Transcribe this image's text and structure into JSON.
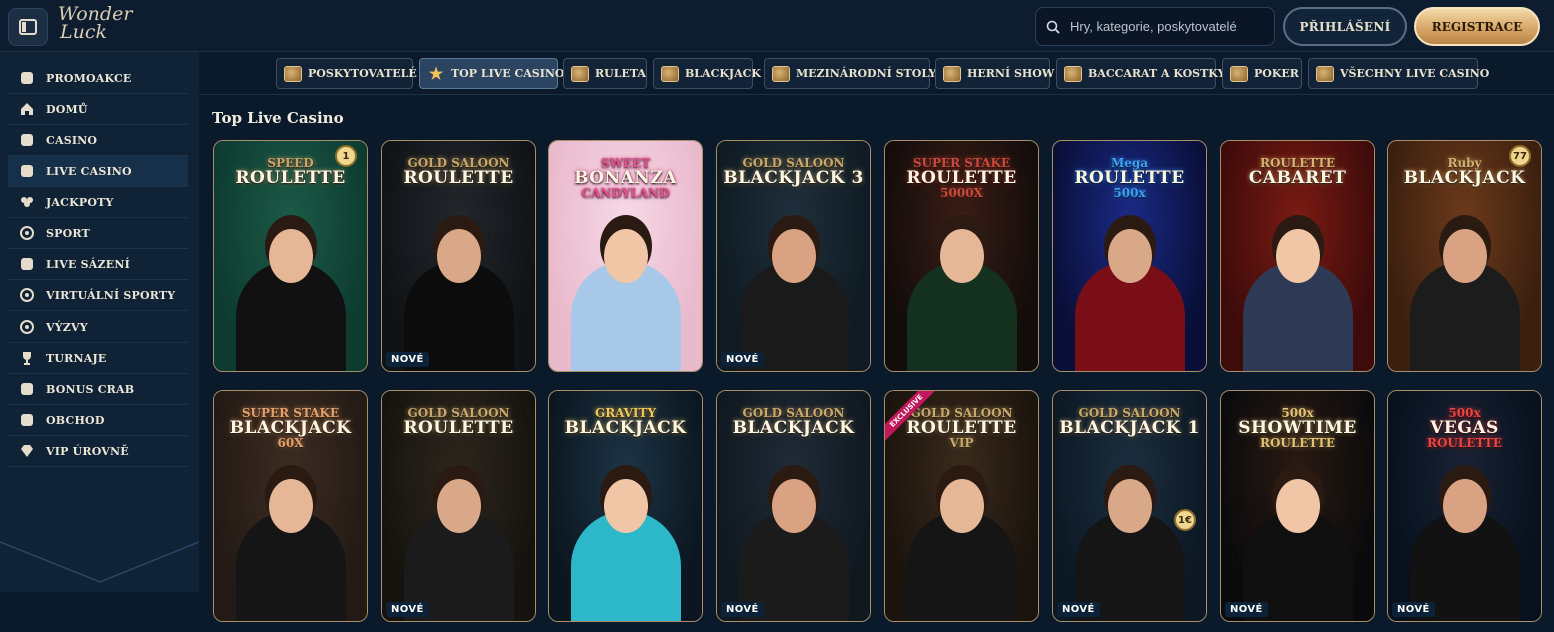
{
  "header": {
    "logo_line1": "Wonder",
    "logo_line2": "Luck",
    "search_placeholder": "Hry, kategorie, poskytovatelé",
    "login_label": "PŘIHLÁŠENÍ",
    "register_label": "REGISTRACE"
  },
  "sidebar": {
    "items": [
      {
        "label": "PROMOAKCE",
        "icon": "gift-icon"
      },
      {
        "label": "DOMŮ",
        "icon": "home-icon"
      },
      {
        "label": "CASINO",
        "icon": "slot-machine-icon"
      },
      {
        "label": "LIVE CASINO",
        "icon": "card-icon"
      },
      {
        "label": "JACKPOTY",
        "icon": "clover-icon"
      },
      {
        "label": "SPORT",
        "icon": "ball-icon"
      },
      {
        "label": "LIVE SÁZENÍ",
        "icon": "live-icon"
      },
      {
        "label": "VIRTUÁLNÍ SPORTY",
        "icon": "gamepad-icon"
      },
      {
        "label": "VÝZVY",
        "icon": "target-icon"
      },
      {
        "label": "TURNAJE",
        "icon": "trophy-icon"
      },
      {
        "label": "BONUS CRAB",
        "icon": "claw-icon"
      },
      {
        "label": "OBCHOD",
        "icon": "bag-icon"
      },
      {
        "label": "VIP ÚROVNĚ",
        "icon": "diamond-icon"
      }
    ]
  },
  "categories": [
    {
      "label": "POSKYTOVATELÉ",
      "icon": "book-icon"
    },
    {
      "label": "TOP LIVE CASINO",
      "icon": "star-icon"
    },
    {
      "label": "RULETA",
      "icon": "roulette-icon"
    },
    {
      "label": "BLACKJACK",
      "icon": "cards-icon"
    },
    {
      "label": "MEZINÁRODNÍ STOLY",
      "icon": "globe-icon"
    },
    {
      "label": "HERNÍ SHOW",
      "icon": "microphone-icon"
    },
    {
      "label": "BACCARAT A KOSTKY",
      "icon": "dice-icon"
    },
    {
      "label": "POKER",
      "icon": "chip-icon"
    },
    {
      "label": "VŠECHNY LIVE CASINO",
      "icon": "grid-icon"
    }
  ],
  "section_title": "Top Live Casino",
  "new_badge": "NOVÉ",
  "tiles": [
    {
      "title": "SPEED ROULETTE",
      "line1": "SPEED",
      "line2": "ROULETTE",
      "new": false,
      "chip": "1"
    },
    {
      "title": "GOLD SALOON ROULETTE",
      "line1": "GOLD SALOON",
      "line2": "ROULETTE",
      "new": true
    },
    {
      "title": "SWEET BONANZA CANDYLAND",
      "line1": "SWEET",
      "line2": "BONANZA",
      "line3": "CANDYLAND",
      "new": false
    },
    {
      "title": "GOLD SALOON BLACKJACK 3",
      "line1": "GOLD SALOON",
      "line2": "BLACKJACK 3",
      "new": true
    },
    {
      "title": "SUPER STAKE ROULETTE 5000X",
      "line1": "SUPER STAKE",
      "line2": "ROULETTE",
      "line3": "5000X",
      "new": false
    },
    {
      "title": "MEGA ROULETTE",
      "line1": "Mega",
      "line2": "ROULETTE",
      "line3": "500x",
      "new": false
    },
    {
      "title": "ROULETTE CABARET",
      "line1": "ROULETTE",
      "line2": "CABARET",
      "new": false
    },
    {
      "title": "RUBY BLACKJACK",
      "line1": "Ruby",
      "line2": "BLACKJACK",
      "new": false,
      "chip": "77"
    },
    {
      "title": "SUPER STAKE BLACKJACK 60X",
      "line1": "SUPER STAKE",
      "line2": "BLACKJACK",
      "line3": "60X",
      "new": false
    },
    {
      "title": "GOLD SALOON ROULETTE",
      "line1": "GOLD SALOON",
      "line2": "ROULETTE",
      "new": true
    },
    {
      "title": "GRAVITY BLACKJACK",
      "line1": "GRAVITY",
      "line2": "BLACKJACK",
      "new": false
    },
    {
      "title": "GOLD SALOON BLACKJACK",
      "line1": "GOLD SALOON",
      "line2": "BLACKJACK",
      "new": true
    },
    {
      "title": "GOLD SALOON ROULETTE VIP",
      "line1": "GOLD SALOON",
      "line2": "ROULETTE",
      "line3": "VIP",
      "new": false,
      "corner": "EXCLUSIVE"
    },
    {
      "title": "GOLD SALOON BLACKJACK 1",
      "line1": "GOLD SALOON",
      "line2": "BLACKJACK 1",
      "new": true,
      "chip": "1€"
    },
    {
      "title": "500X SHOWTIME ROULETTE",
      "line1": "500x",
      "line2": "SHOWTIME",
      "line3": "ROULETTE",
      "new": true
    },
    {
      "title": "500X VEGAS ROULETTE",
      "line1": "500x",
      "line2": "VEGAS",
      "line3": "ROULETTE",
      "new": true
    }
  ]
}
